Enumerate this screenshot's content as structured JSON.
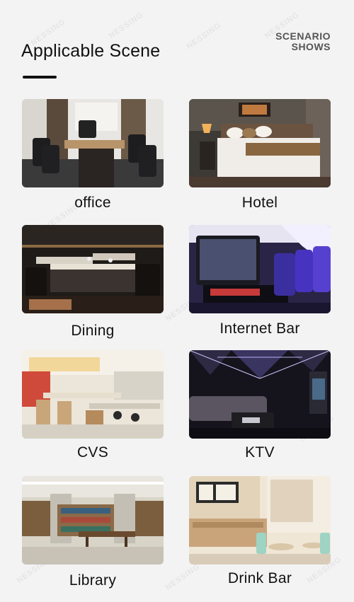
{
  "header": {
    "title": "Applicable Scene",
    "badge_line1": "SCENARIO",
    "badge_line2": "SHOWS"
  },
  "watermark_text": "NESSING",
  "scenes": [
    {
      "label": "office",
      "icon": "office-photo"
    },
    {
      "label": "Hotel",
      "icon": "hotel-photo"
    },
    {
      "label": "Dining",
      "icon": "dining-photo"
    },
    {
      "label": "Internet Bar",
      "icon": "internet-bar-photo"
    },
    {
      "label": "CVS",
      "icon": "cvs-photo"
    },
    {
      "label": "KTV",
      "icon": "ktv-photo"
    },
    {
      "label": "Library",
      "icon": "library-photo"
    },
    {
      "label": "Drink Bar",
      "icon": "drink-bar-photo"
    }
  ]
}
